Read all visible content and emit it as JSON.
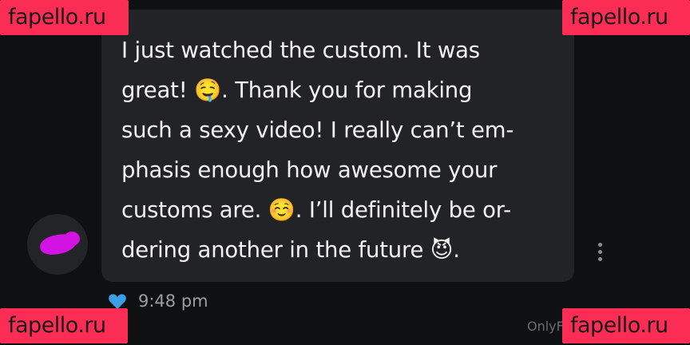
{
  "watermark": {
    "label": "fapello.ru"
  },
  "message": {
    "text": "I just watched the custom. It was\ngreat! 🤤. Thank you for making\nsuch a sexy video! I really can’t em-\nphasis enough how awesome your\ncustoms are. ☺️. I’ll definitely be or-\ndering another in the future 😈."
  },
  "meta": {
    "time": "9:48 pm",
    "liked": true
  },
  "footer": {
    "url": "OnlyF"
  },
  "colors": {
    "watermark": "#fb2d55",
    "heart": "#3b9fe8",
    "avatar_blob": "#d313e4",
    "bubble": "#222326"
  },
  "icons": {
    "more": "vertical-dots-icon",
    "like": "heart-icon"
  }
}
